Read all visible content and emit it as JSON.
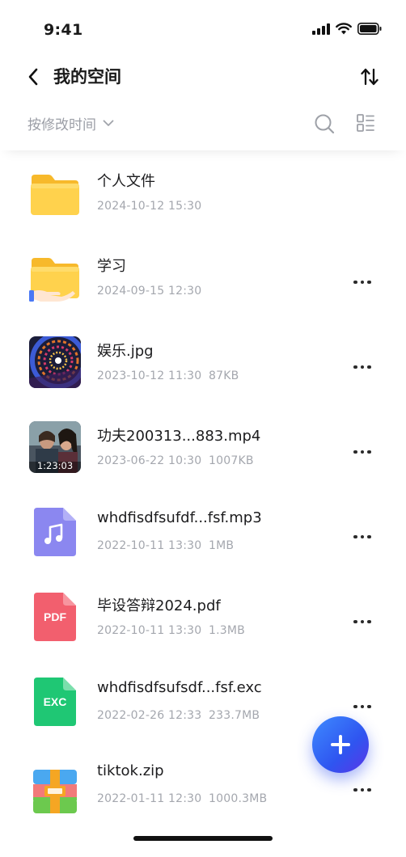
{
  "status_bar": {
    "time": "9:41"
  },
  "nav": {
    "title": "我的空间",
    "back_icon": "chevron-left-icon",
    "sort_icon": "sort-arrows-icon"
  },
  "filter": {
    "sort_label": "按修改时间",
    "search_icon": "search-icon",
    "view_icon": "list-view-icon"
  },
  "files": [
    {
      "name": "个人文件",
      "date": "2024-10-12  15:30",
      "size": "",
      "icon": "folder-icon",
      "has_more": false
    },
    {
      "name": "学习",
      "date": "2024-09-15  12:30",
      "size": "",
      "icon": "shared-folder-icon",
      "has_more": true
    },
    {
      "name": "娱乐.jpg",
      "date": "2023-10-12  11:30",
      "size": "87KB",
      "icon": "image-thumbnail",
      "has_more": true
    },
    {
      "name": "功夫200313...883.mp4",
      "date": "2023-06-22  10:30",
      "size": "1007KB",
      "icon": "video-thumbnail",
      "duration": "1:23:03",
      "has_more": true
    },
    {
      "name": "whdfisdfsufdf...fsf.mp3",
      "date": "2022-10-11  13:30",
      "size": "1MB",
      "icon": "music-file-icon",
      "has_more": true
    },
    {
      "name": "毕设答辩2024.pdf",
      "date": "2022-10-11  13:30",
      "size": "1.3MB",
      "icon": "pdf-file-icon",
      "label": "PDF",
      "has_more": true
    },
    {
      "name": "whdfisdfsufsdf...fsf.exc",
      "date": "2022-02-26  12:33",
      "size": "233.7MB",
      "icon": "excel-file-icon",
      "label": "EXC",
      "has_more": true
    },
    {
      "name": "tiktok.zip",
      "date": "2022-01-11  12:30",
      "size": "1000.3MB",
      "icon": "zip-file-icon",
      "has_more": true
    }
  ],
  "fab": {
    "icon": "plus-icon"
  },
  "colors": {
    "accent": "#2f5cf2",
    "muted": "#a4a7ae",
    "folder": "#ffd24d",
    "music": "#8b87f0",
    "pdf": "#f25f6e",
    "excel": "#1fc774"
  }
}
